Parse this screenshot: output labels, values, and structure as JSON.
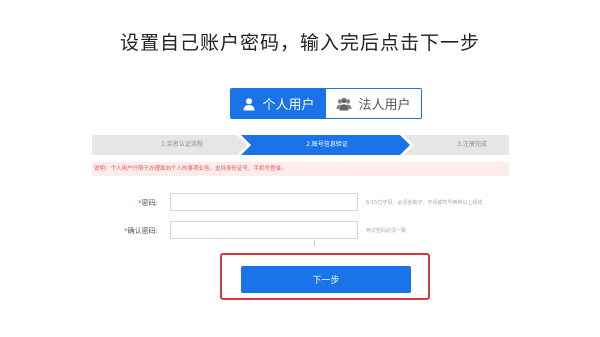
{
  "heading": "设置自己账户密码，输入完后点击下一步",
  "user_type_tabs": [
    {
      "label": "个人用户",
      "icon": "person-icon",
      "active": true
    },
    {
      "label": "法人用户",
      "icon": "group-icon",
      "active": false
    }
  ],
  "steps": [
    {
      "label": "1.实名认证流程",
      "state": "done"
    },
    {
      "label": "2.账号信息验证",
      "state": "active"
    },
    {
      "label": "3.注册完成",
      "state": "pending"
    }
  ],
  "notice": "说明：个人用户只限于办理面向个人的事项业务，支持身份证号、手机号登录。",
  "form": {
    "password_label": "密码:",
    "password_hint": "6-15位字母、必须含数字、字母或符号两种以上组成",
    "confirm_label": "确认密码:",
    "confirm_hint": "两次密码必须一致"
  },
  "next_button": "下一步",
  "colors": {
    "primary": "#1a73e8",
    "highlight": "#d9373d",
    "notice_bg": "#fdecec",
    "notice_text": "#e0595b"
  }
}
